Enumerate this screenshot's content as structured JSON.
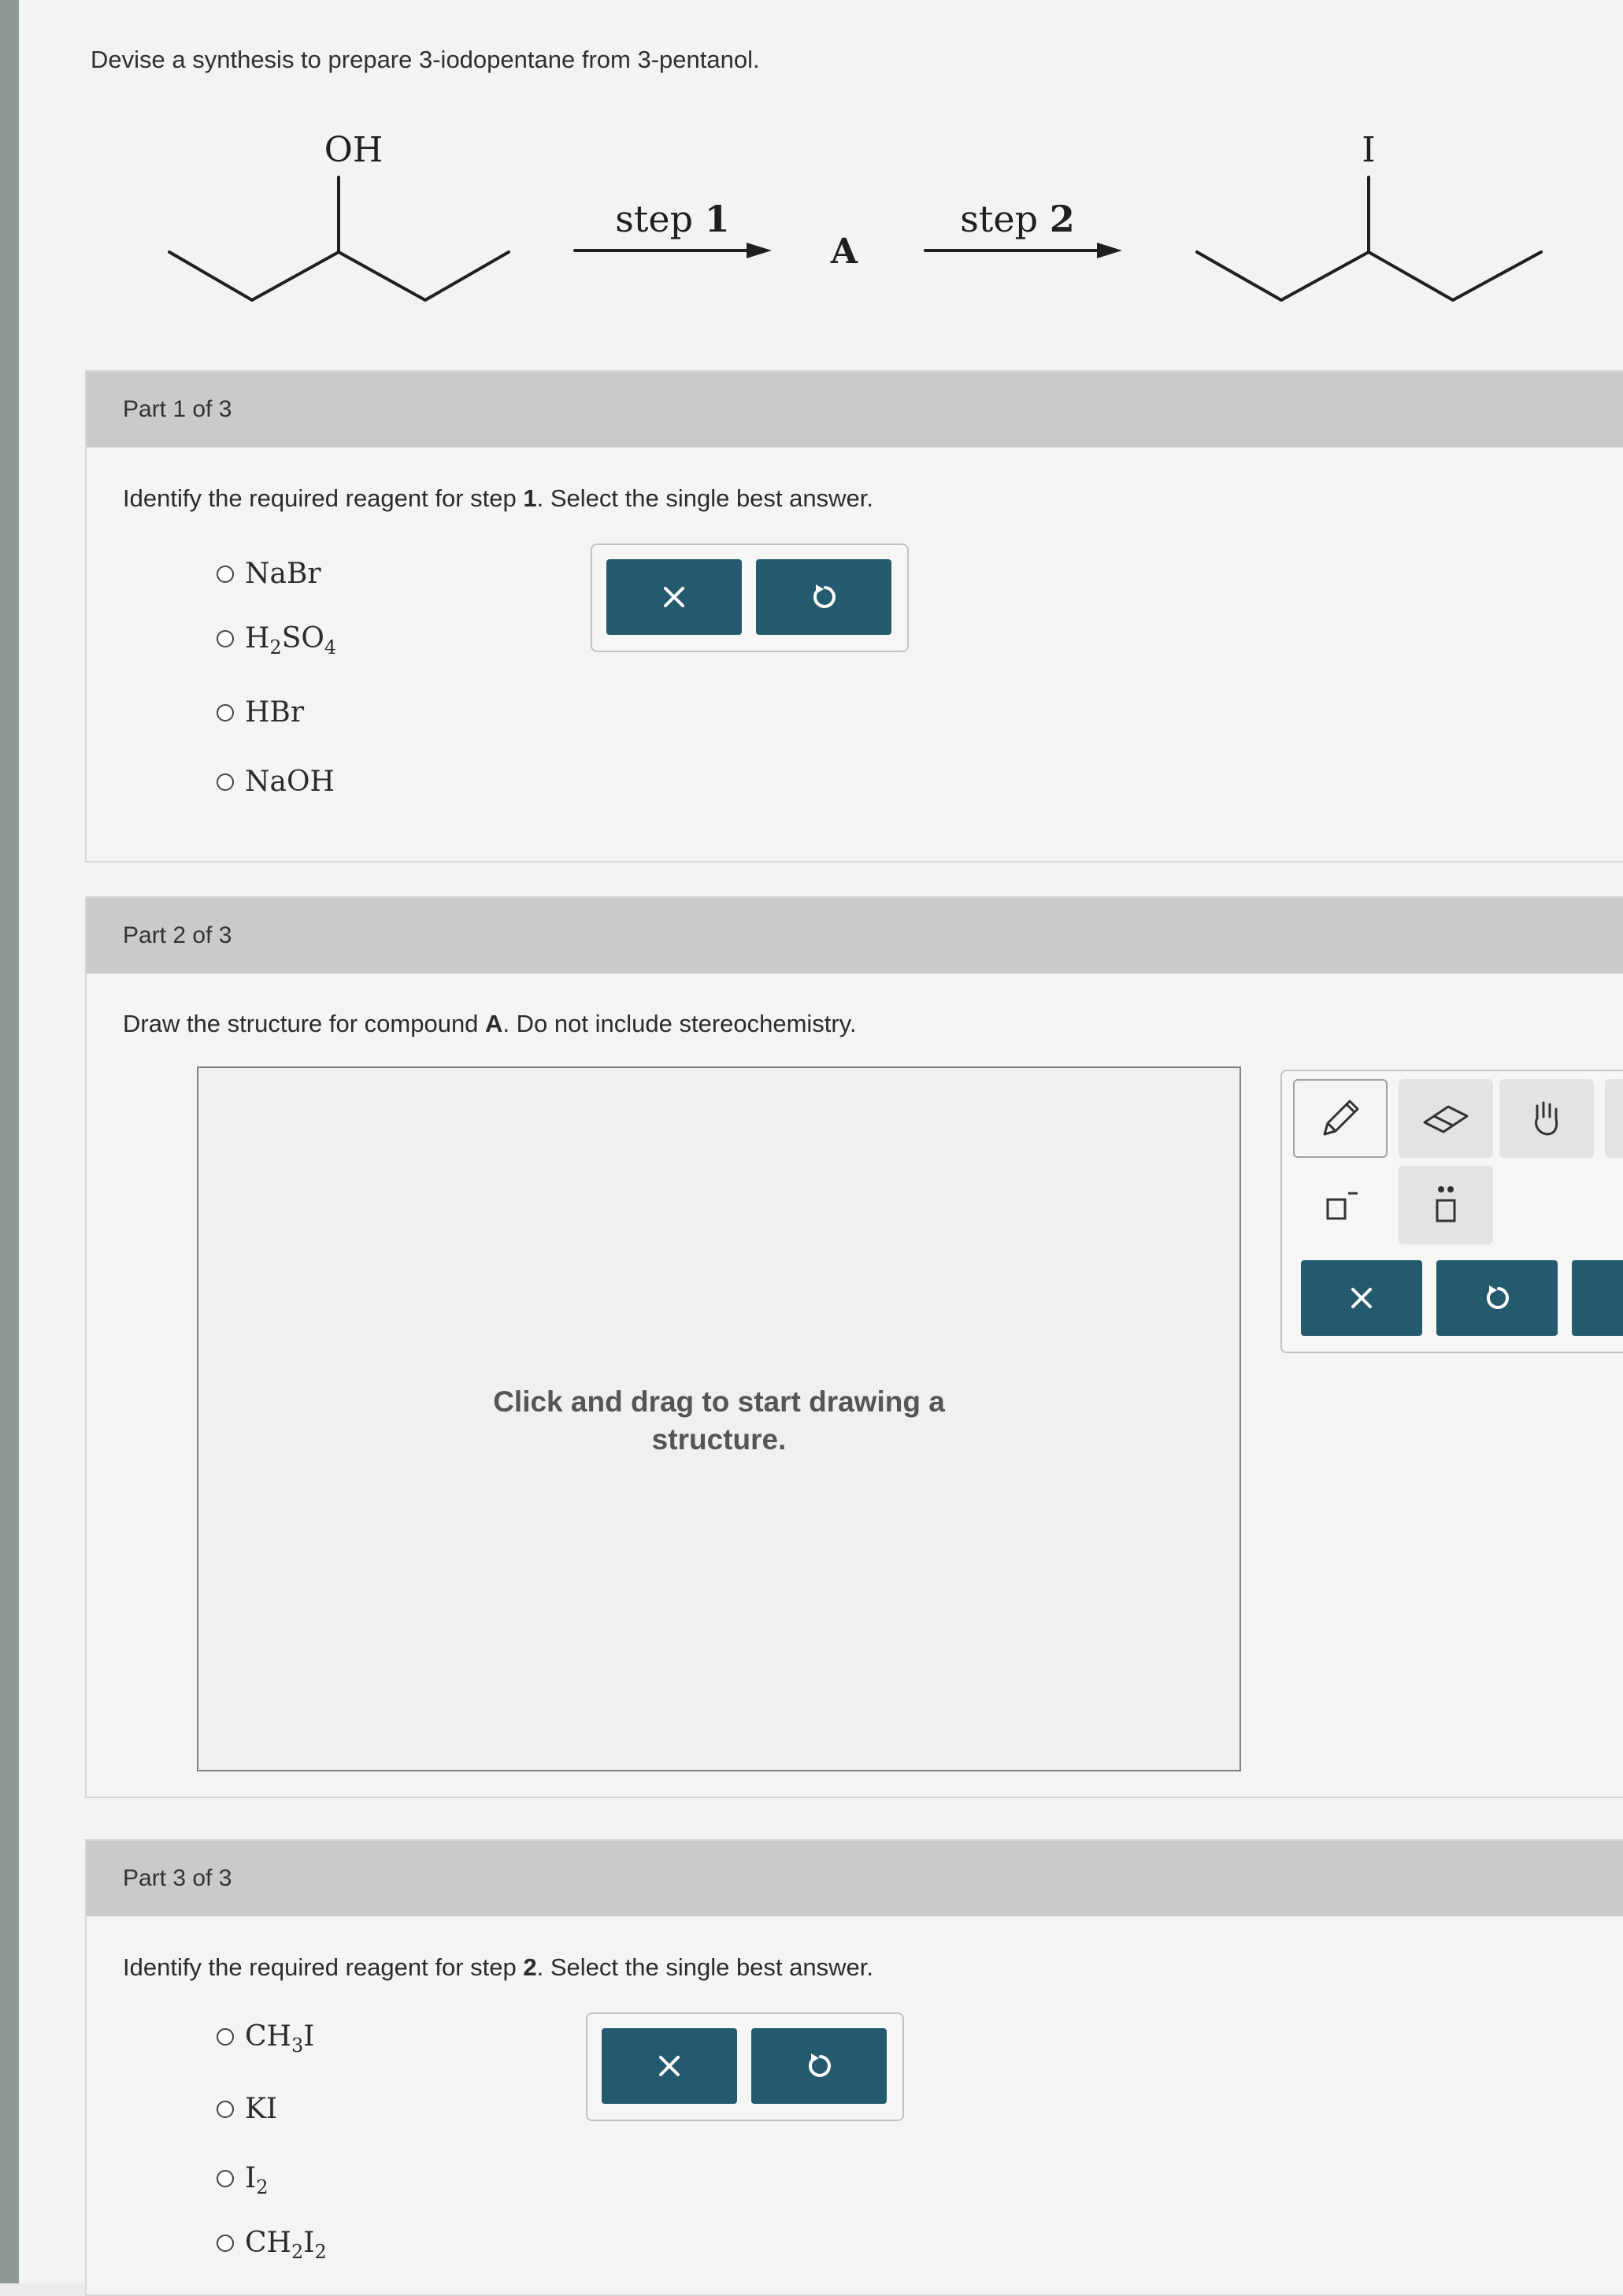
{
  "intro": "Devise a synthesis to prepare 3-iodopentane from 3-pentanol.",
  "scheme": {
    "start_label": "OH",
    "step1_word": "step",
    "step1_num": "1",
    "intermediate": "A",
    "step2_word": "step",
    "step2_num": "2",
    "product_label": "I"
  },
  "part1": {
    "header": "Part 1 of 3",
    "question_a": "Identify the required reagent for step ",
    "question_num": "1",
    "question_b": ". Select the single best answer.",
    "options": [
      {
        "main": "NaBr"
      },
      {
        "main": "H",
        "sub1": "2",
        "mid": "SO",
        "sub2": "4"
      },
      {
        "main": "HBr"
      },
      {
        "main": "NaOH"
      }
    ]
  },
  "part2": {
    "header": "Part 2 of 3",
    "question_a": "Draw the structure for compound ",
    "question_bold": "A",
    "question_b": ". Do not include stereochemistry.",
    "hint_line1": "Click and drag to start drawing a",
    "hint_line2": "structure."
  },
  "part3": {
    "header": "Part 3 of 3",
    "question_a": "Identify the required reagent for step ",
    "question_num": "2",
    "question_b": ". Select the single best answer.",
    "options": [
      {
        "main": "CH",
        "sub1": "3",
        "mid": "I"
      },
      {
        "main": "KI"
      },
      {
        "main": "I",
        "sub1": "2"
      },
      {
        "main": "CH",
        "sub1": "2",
        "mid": "I",
        "sub2": "2"
      }
    ]
  },
  "icons": {
    "clear": "close-icon",
    "undo": "undo-icon",
    "draw": "pencil-icon",
    "erase": "eraser-icon",
    "pan": "hand-icon",
    "charge": "charge-icon",
    "lone_pair": "lone-pair-icon"
  },
  "colors": {
    "button": "#245a6e",
    "header": "#c9cbc9"
  }
}
